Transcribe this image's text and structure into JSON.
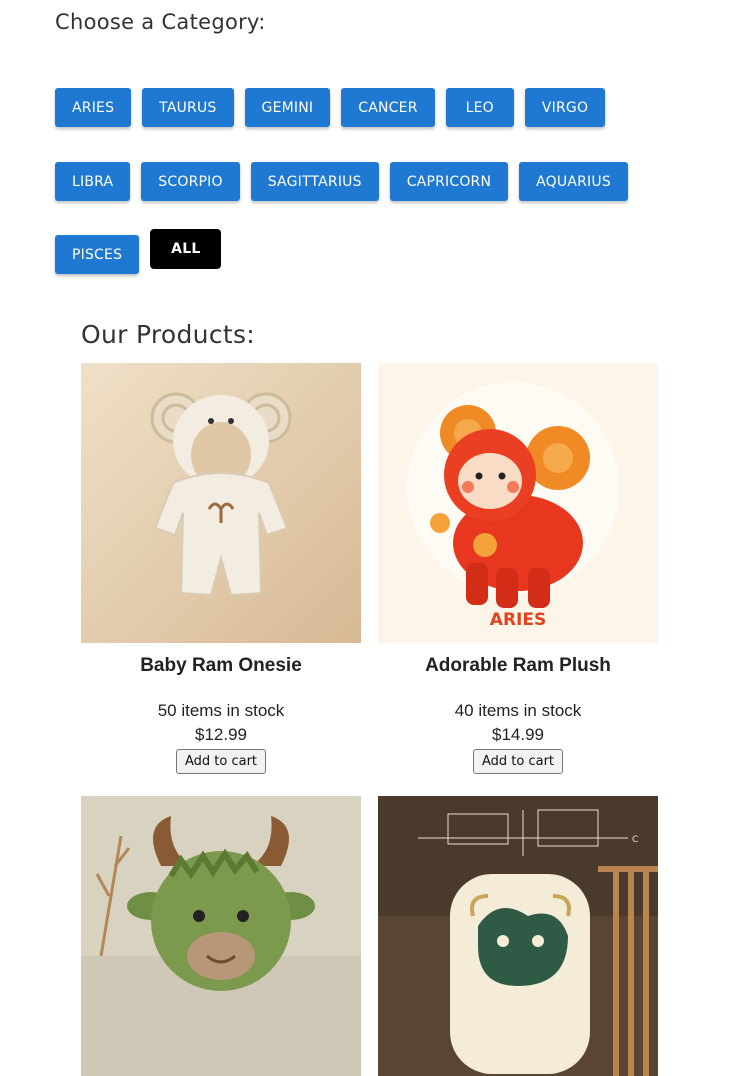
{
  "categories": {
    "heading": "Choose a Category:",
    "rows": [
      [
        "ARIES",
        "TAURUS",
        "GEMINI",
        "CANCER",
        "LEO",
        "VIRGO"
      ],
      [
        "LIBRA",
        "SCORPIO",
        "SAGITTARIUS",
        "CAPRICORN",
        "AQUARIUS"
      ],
      [
        "PISCES"
      ]
    ],
    "all_label": "ALL"
  },
  "products": {
    "heading": "Our Products:",
    "items": [
      {
        "name": "Baby Ram Onesie",
        "stock": "50 items in stock",
        "price": "$12.99",
        "button": "Add to cart"
      },
      {
        "name": "Adorable Ram Plush",
        "stock": "40 items in stock",
        "price": "$14.99",
        "button": "Add to cart",
        "image_text": "ARIES"
      },
      {
        "name": "",
        "stock": "",
        "price": "",
        "button": ""
      },
      {
        "name": "",
        "stock": "",
        "price": "",
        "button": ""
      }
    ]
  },
  "colors": {
    "category_button": "#1f78d1",
    "all_button": "#000000"
  }
}
